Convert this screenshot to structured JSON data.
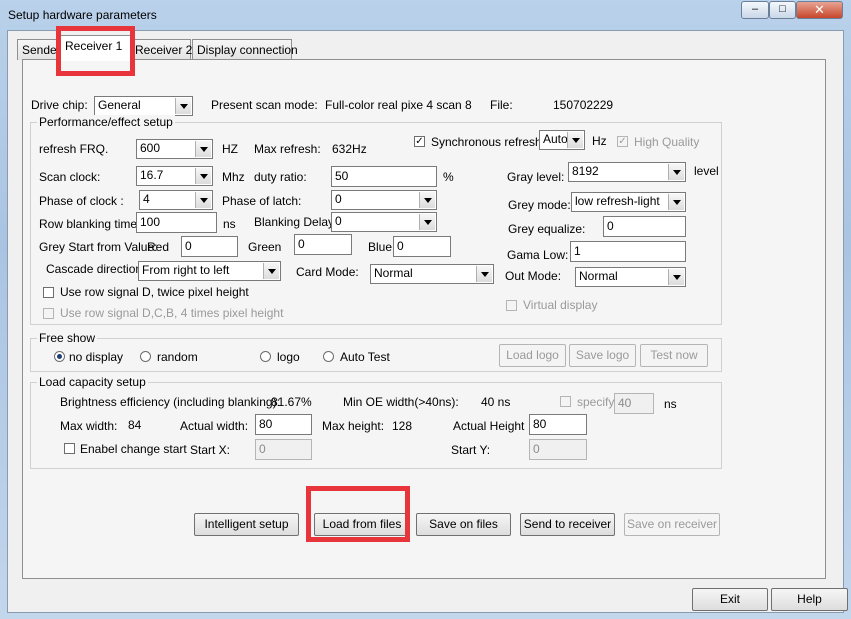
{
  "window": {
    "title": "Setup hardware parameters",
    "min": "–",
    "max": "□",
    "close": "✕"
  },
  "tabs": [
    "Sende",
    "Receiver 1",
    "Receiver 2",
    "Display connection"
  ],
  "top": {
    "drive_chip_label": "Drive chip:",
    "drive_chip_value": "General",
    "present_scan_label": "Present scan mode:",
    "present_scan_value": "Full-color real pixe 4 scan 8",
    "file_label": "File:",
    "file_value": "150702229"
  },
  "perf": {
    "title": "Performance/effect setup",
    "refresh_label": "refresh FRQ.",
    "refresh_value": "600",
    "hz": "HZ",
    "max_refresh_label": "Max refresh:",
    "max_refresh_value": "632Hz",
    "sync_label": "Synchronous refresh",
    "sync_value": "Auto",
    "sync_unit": "Hz",
    "hq_label": "High Quality",
    "scan_clock_label": "Scan clock:",
    "scan_clock_value": "16.7",
    "mhz": "Mhz",
    "duty_label": "duty ratio:",
    "duty_value": "50",
    "pct": "%",
    "gray_level_label": "Gray level:",
    "gray_level_value": "8192",
    "level": "level",
    "phase_clock_label": "Phase of clock :",
    "phase_clock_value": "4",
    "phase_latch_label": "Phase of latch:",
    "phase_latch_value": "0",
    "grey_mode_label": "Grey mode:",
    "grey_mode_value": "low refresh-light",
    "row_blank_label": "Row blanking time",
    "row_blank_value": "100",
    "ns": "ns",
    "blank_delay_label": "Blanking Delay:",
    "blank_delay_value": "0",
    "grey_eq_label": "Grey equalize:",
    "grey_eq_value": "0",
    "grey_start_label": "Grey Start from Value:",
    "red_label": "Red",
    "red_value": "0",
    "green_label": "Green",
    "green_value": "0",
    "blue_label": "Blue",
    "blue_value": "0",
    "gama_label": "Gama Low:",
    "gama_value": "1",
    "cascade_label": "Cascade direction:",
    "cascade_value": "From right to left",
    "card_mode_label": "Card Mode:",
    "card_mode_value": "Normal",
    "out_mode_label": "Out Mode:",
    "out_mode_value": "Normal",
    "row_signal_d_label": "Use row signal D, twice pixel height",
    "row_signal_dcb_label": "Use row signal D,C,B, 4 times pixel height",
    "virtual_label": "Virtual display",
    "check": "✓"
  },
  "free_show": {
    "title": "Free show",
    "options": [
      "no display",
      "random",
      "logo",
      "Auto Test"
    ],
    "load_logo": "Load logo",
    "save_logo": "Save logo",
    "test_now": "Test now"
  },
  "load_cap": {
    "title": "Load capacity setup",
    "bright_label": "Brightness efficiency (including blanking):",
    "bright_value": "81.67%",
    "min_oe_label": "Min OE width(>40ns):",
    "min_oe_value": "40 ns",
    "specify_label": "specify",
    "specify_value": "40",
    "ns": "ns",
    "max_width_label": "Max width:",
    "max_width_value": "84",
    "actual_width_label": "Actual width:",
    "actual_width_value": "80",
    "max_height_label": "Max height:",
    "max_height_value": "128",
    "actual_height_label": "Actual Height",
    "actual_height_value": "80",
    "enable_change_label": "Enabel change start",
    "start_x_label": "Start X:",
    "start_x_value": "0",
    "start_y_label": "Start Y:",
    "start_y_value": "0"
  },
  "actions": {
    "intelligent": "Intelligent setup",
    "load_files": "Load from files",
    "save_files": "Save on files",
    "send_receiver": "Send to receiver",
    "save_receiver": "Save on receiver"
  },
  "footer": {
    "exit": "Exit",
    "help": "Help"
  },
  "colors": {
    "highlight": "#e8343b",
    "title_bg": "#b9d1ea",
    "close_btn": "#c7452b"
  }
}
